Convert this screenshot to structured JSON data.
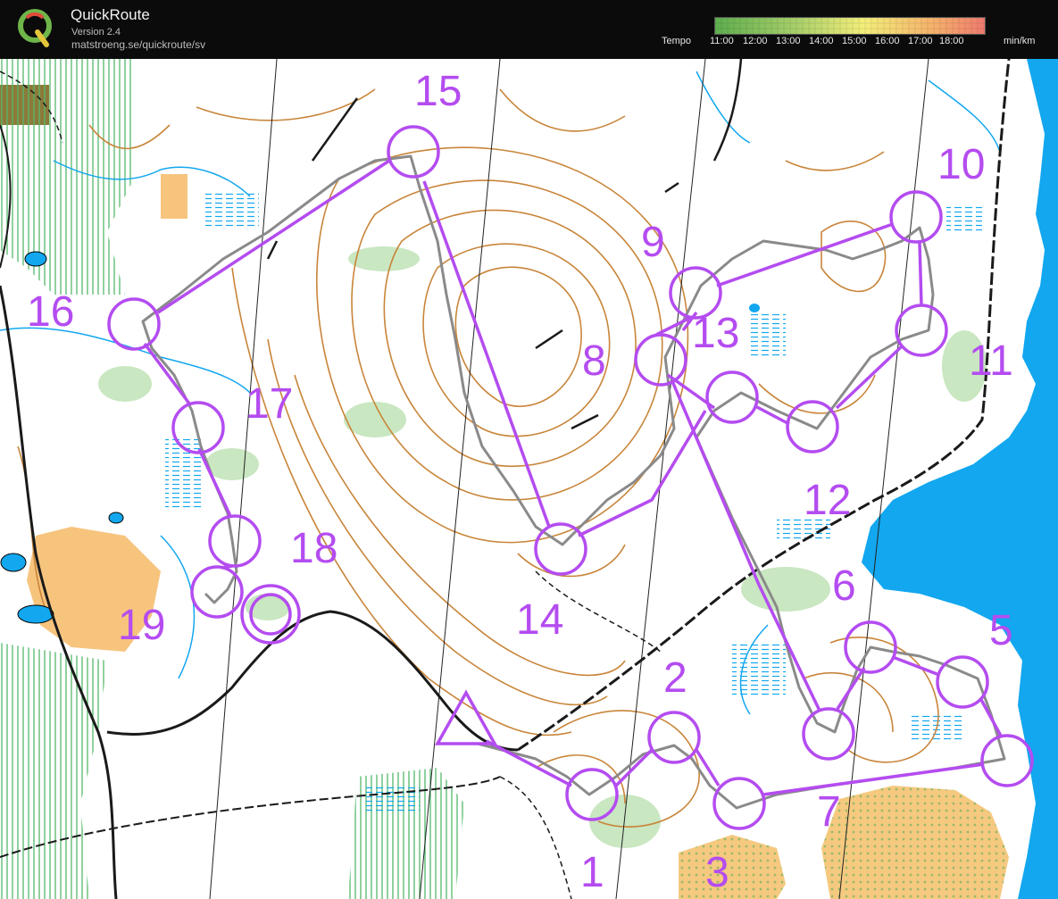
{
  "app": {
    "title": "QuickRoute",
    "version": "Version 2.4",
    "url": "matstroeng.se/quickroute/sv"
  },
  "tempo_legend": {
    "label": "Tempo",
    "ticks": [
      "11:00",
      "12:00",
      "13:00",
      "14:00",
      "15:00",
      "16:00",
      "17:00",
      "18:00"
    ],
    "unit": "min/km",
    "gradient_colors": [
      "#5fae4f",
      "#a8cf6a",
      "#f3ee7a",
      "#f5b46c",
      "#ef7b6e"
    ]
  },
  "map": {
    "colors": {
      "course": "#b44cf0",
      "route": "#8a8a8a",
      "water": "#12a7ef",
      "contour": "#c8853a",
      "vegetation": "#c9e7c1",
      "open_land": "#f7c47e",
      "road": "#1a1a1a"
    },
    "controls": [
      "1",
      "2",
      "3",
      "5",
      "6",
      "7",
      "8",
      "9",
      "10",
      "11",
      "12",
      "13",
      "14",
      "15",
      "16",
      "17",
      "18",
      "19"
    ]
  }
}
